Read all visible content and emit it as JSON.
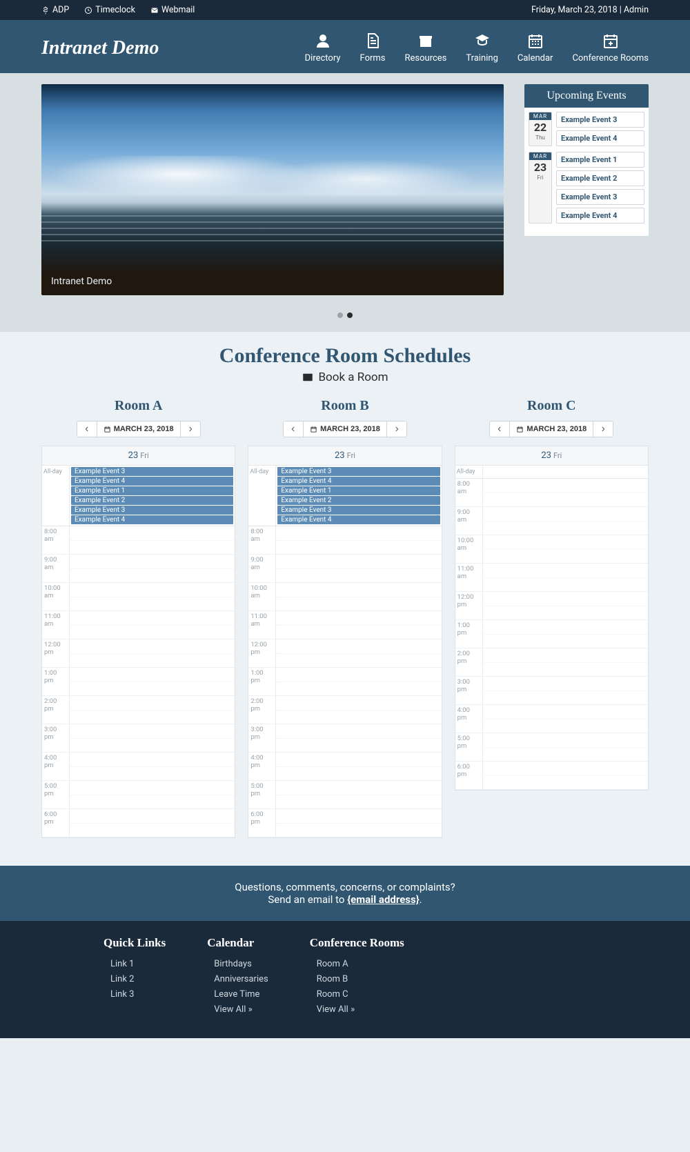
{
  "topbar": {
    "links": [
      {
        "label": "ADP",
        "icon": "dollar"
      },
      {
        "label": "Timeclock",
        "icon": "clock"
      },
      {
        "label": "Webmail",
        "icon": "mail"
      }
    ],
    "right_text": "Friday, March 23, 2018 | Admin"
  },
  "brand": "Intranet Demo",
  "nav": [
    {
      "label": "Directory",
      "icon": "user"
    },
    {
      "label": "Forms",
      "icon": "file"
    },
    {
      "label": "Resources",
      "icon": "box"
    },
    {
      "label": "Training",
      "icon": "gradcap"
    },
    {
      "label": "Calendar",
      "icon": "calendar"
    },
    {
      "label": "Conference Rooms",
      "icon": "calplus"
    }
  ],
  "hero": {
    "caption": "Intranet Demo",
    "active_dot": 1,
    "dots": 2
  },
  "upcoming": {
    "title": "Upcoming Events",
    "days": [
      {
        "month": "MAR",
        "day": "22",
        "weekday": "Thu",
        "events": [
          "Example Event 3",
          "Example Event 4"
        ]
      },
      {
        "month": "MAR",
        "day": "23",
        "weekday": "Fri",
        "events": [
          "Example Event 1",
          "Example Event 2",
          "Example Event 3",
          "Example Event 4"
        ]
      }
    ]
  },
  "schedules": {
    "title": "Conference Room Schedules",
    "book_label": "Book a Room",
    "rooms": [
      {
        "name": "Room A",
        "date_label": "MARCH 23, 2018",
        "day_header": {
          "num": "23",
          "day": "Fri"
        },
        "allday": [
          "Example Event 3",
          "Example Event 4",
          "Example Event 1",
          "Example Event 2",
          "Example Event 3",
          "Example Event 4"
        ],
        "time_labels": [
          "8:00 am",
          "9:00 am",
          "10:00 am",
          "11:00 am",
          "12:00 pm",
          "1:00 pm",
          "2:00 pm",
          "3:00 pm",
          "4:00 pm",
          "5:00 pm",
          "6:00 pm"
        ]
      },
      {
        "name": "Room B",
        "date_label": "MARCH 23, 2018",
        "day_header": {
          "num": "23",
          "day": "Fri"
        },
        "allday": [
          "Example Event 3",
          "Example Event 4",
          "Example Event 1",
          "Example Event 2",
          "Example Event 3",
          "Example Event 4"
        ],
        "time_labels": [
          "8:00 am",
          "9:00 am",
          "10:00 am",
          "11:00 am",
          "12:00 pm",
          "1:00 pm",
          "2:00 pm",
          "3:00 pm",
          "4:00 pm",
          "5:00 pm",
          "6:00 pm"
        ]
      },
      {
        "name": "Room C",
        "date_label": "MARCH 23, 2018",
        "day_header": {
          "num": "23",
          "day": "Fri"
        },
        "allday": [],
        "time_labels": [
          "8:00 am",
          "9:00 am",
          "10:00 am",
          "11:00 am",
          "12:00 pm",
          "1:00 pm",
          "2:00 pm",
          "3:00 pm",
          "4:00 pm",
          "5:00 pm",
          "6:00 pm"
        ]
      }
    ],
    "allday_label": "All-day"
  },
  "contact": {
    "line1": "Questions, comments, concerns, or complaints?",
    "line2_a": "Send an email to ",
    "line2_b": "{email address}",
    "line2_c": "."
  },
  "footer": [
    {
      "title": "Quick Links",
      "links": [
        "Link 1",
        "Link 2",
        "Link 3"
      ]
    },
    {
      "title": "Calendar",
      "links": [
        "Birthdays",
        "Anniversaries",
        "Leave Time",
        "View All »"
      ]
    },
    {
      "title": "Conference Rooms",
      "links": [
        "Room A",
        "Room B",
        "Room C",
        "View All »"
      ]
    }
  ]
}
